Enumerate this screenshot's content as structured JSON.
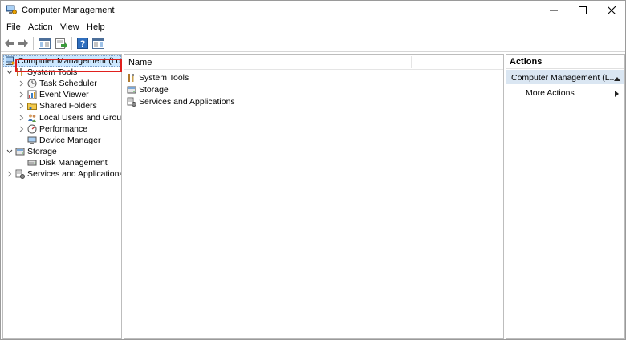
{
  "window": {
    "title": "Computer Management"
  },
  "menu": {
    "items": [
      "File",
      "Action",
      "View",
      "Help"
    ]
  },
  "toolbar": {
    "buttons": [
      "back-icon",
      "forward-icon",
      "show-hide-tree-icon",
      "export-list-icon",
      "help-icon",
      "show-hide-action-pane-icon"
    ]
  },
  "tree": {
    "root": "Computer Management (Local",
    "system_tools": "System Tools",
    "task_scheduler": "Task Scheduler",
    "event_viewer": "Event Viewer",
    "shared_folders": "Shared Folders",
    "local_users_groups": "Local Users and Groups",
    "performance": "Performance",
    "device_manager": "Device Manager",
    "storage": "Storage",
    "disk_management": "Disk Management",
    "services_apps": "Services and Applications"
  },
  "list": {
    "column_name": "Name",
    "rows": [
      "System Tools",
      "Storage",
      "Services and Applications"
    ]
  },
  "actions": {
    "title": "Actions",
    "section": "Computer Management (L...",
    "more_actions": "More Actions"
  },
  "colors": {
    "selection": "#cce8ff",
    "actions_section": "#dae6f2",
    "highlight_box": "#e0201e"
  }
}
